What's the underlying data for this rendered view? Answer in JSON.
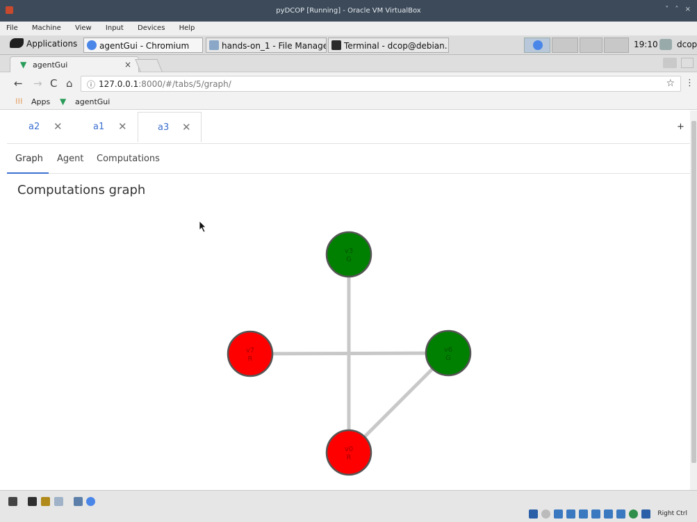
{
  "vbox": {
    "title": "pyDCOP [Running] - Oracle VM VirtualBox",
    "window_controls": "˅ ˄ ×",
    "menu": [
      "File",
      "Machine",
      "View",
      "Input",
      "Devices",
      "Help"
    ],
    "host_key": "Right Ctrl"
  },
  "panel": {
    "applications": "Applications",
    "tasks": [
      "agentGui - Chromium",
      "hands-on_1 - File Manager",
      "Terminal - dcop@debian..."
    ],
    "clock": "19:10",
    "user": "dcop"
  },
  "browser": {
    "tab_title": "agentGui",
    "tab_close": "×",
    "url_host": "127.0.0.1",
    "url_rest": ":8000/#/tabs/5/graph/",
    "bookmarks": [
      "Apps",
      "agentGui"
    ]
  },
  "app": {
    "agent_tabs": [
      {
        "label": "a2",
        "close": "✕"
      },
      {
        "label": "a1",
        "close": "✕"
      },
      {
        "label": "a3",
        "close": "✕"
      }
    ],
    "add_tab": "+",
    "subtabs": [
      "Graph",
      "Agent",
      "Computations"
    ],
    "page_title": "Computations graph"
  },
  "graph": {
    "nodes": [
      {
        "id": "v3",
        "value": "G",
        "color": "#008000"
      },
      {
        "id": "v7",
        "value": "R",
        "color": "#ff0000"
      },
      {
        "id": "v6",
        "value": "G",
        "color": "#008000"
      },
      {
        "id": "v0",
        "value": "R",
        "color": "#ff0000"
      }
    ],
    "edges": [
      [
        "v3",
        "v0"
      ],
      [
        "v7",
        "v6"
      ],
      [
        "v6",
        "v0"
      ]
    ]
  },
  "colors": {
    "link_blue": "#3b6fd0",
    "node_green": "#008000",
    "node_red": "#ff0000",
    "edge_gray": "#c8c8c8"
  }
}
